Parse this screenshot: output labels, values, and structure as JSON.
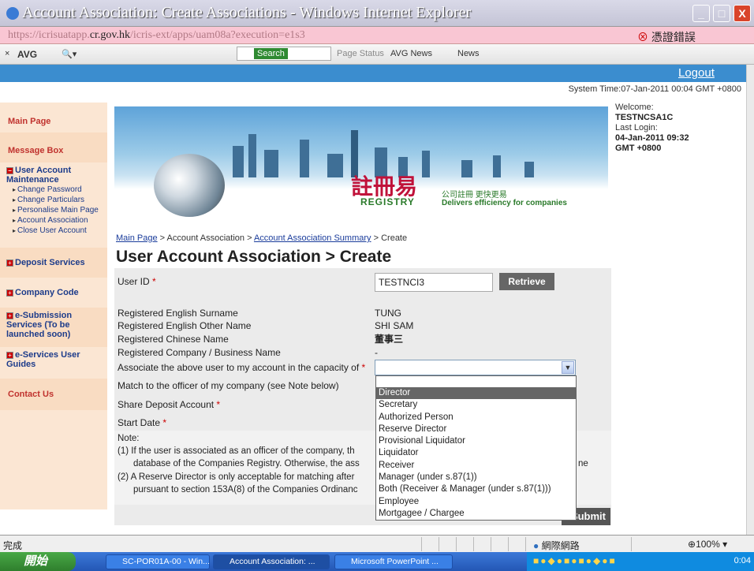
{
  "window": {
    "title": "Account Association: Create Associations - Windows Internet Explorer",
    "buttons": [
      "_",
      "□",
      "X"
    ]
  },
  "address_bar": {
    "url_prefix": "https://icrisuatapp.",
    "url_domain": "cr.gov.hk",
    "url_suffix": "/icris-ext/apps/uam08a?execution=e1s3",
    "cert_error": "憑證錯誤"
  },
  "toolbar": {
    "avg_label": "AVG",
    "search_label": "Search",
    "page_status": "Page Status",
    "avg_news": "AVG News",
    "news": "News"
  },
  "header": {
    "logout": "Logout",
    "system_time": "System Time:07-Jan-2011 00:04 GMT +0800"
  },
  "sidebar": {
    "main_page": "Main Page",
    "message_box": "Message Box",
    "user_account_maintenance": "User Account Maintenance",
    "uam_items": [
      "Change Password",
      "Change Particulars",
      "Personalise Main Page",
      "Account Association",
      "Close User Account"
    ],
    "deposit_services": "Deposit Services",
    "company_code": "Company Code",
    "esubmission": "e-Submission Services (To be launched soon)",
    "eservices_guides": "e-Services User Guides",
    "contact_us": "Contact Us"
  },
  "banner": {
    "registry_cn": "註冊易",
    "registry_en": "REGISTRY",
    "tagline_cn": "公司註冊 更快更易",
    "tagline_en": "Delivers efficiency for companies"
  },
  "welcome": {
    "welcome_label": "Welcome:",
    "username": "TESTNCSA1C",
    "last_login_label": "Last Login:",
    "last_login": "04-Jan-2011 09:32",
    "last_login_tz": "GMT +0800"
  },
  "breadcrumb": {
    "main_page": "Main Page",
    "sep": ">",
    "account_association": "Account Association",
    "summary": "Account Association Summary",
    "create": "Create"
  },
  "page_title": "User Account Association > Create",
  "form": {
    "user_id_label": "User ID",
    "user_id_value": "TESTNCI3",
    "retrieve": "Retrieve",
    "surname_label": "Registered English Surname",
    "surname_value": "TUNG",
    "other_name_label": "Registered English Other Name",
    "other_name_value": "SHI SAM",
    "chinese_name_label": "Registered Chinese Name",
    "chinese_name_value": "董事三",
    "company_name_label": "Registered Company / Business Name",
    "company_name_value": "-",
    "capacity_label": "Associate the above user to my account in the capacity of",
    "match_label": "Match to the officer of my company (see Note below)",
    "share_deposit_label": "Share Deposit Account",
    "start_date_label": "Start Date",
    "required_mark": "*",
    "submit": "Submit"
  },
  "notes": {
    "heading": "Note:",
    "n1_a": "(1)  If the user is associated as an officer of the company, th",
    "n1_b": "database of the Companies Registry. Otherwise, the ass",
    "n1_tail": "ne",
    "n2_a": "(2)  A Reserve Director is only acceptable for matching after",
    "n2_b": "pursuant to section 153A(8) of the Companies Ordinanc"
  },
  "capacity_options": [
    "Director",
    "Secretary",
    "Authorized Person",
    "Reserve Director",
    "Provisional Liquidator",
    "Liquidator",
    "Receiver",
    "Manager (under s.87(1))",
    "Both (Receiver & Manager (under s.87(1)))",
    "Employee",
    "Mortgagee / Chargee"
  ],
  "capacity_selected": "Director",
  "statusbar": {
    "done": "完成",
    "zone": "網際網路",
    "zoom": "100%"
  },
  "taskbar": {
    "start": "開始",
    "tasks": [
      "SC-POR01A-00 - Win...",
      "Account Association: ...",
      "Microsoft PowerPoint ..."
    ],
    "clock": "0:04"
  },
  "colors": {
    "accent_blue": "#3b8dcf",
    "sidebar_bg": "#fbe6d3",
    "link_red": "#c0322e"
  }
}
